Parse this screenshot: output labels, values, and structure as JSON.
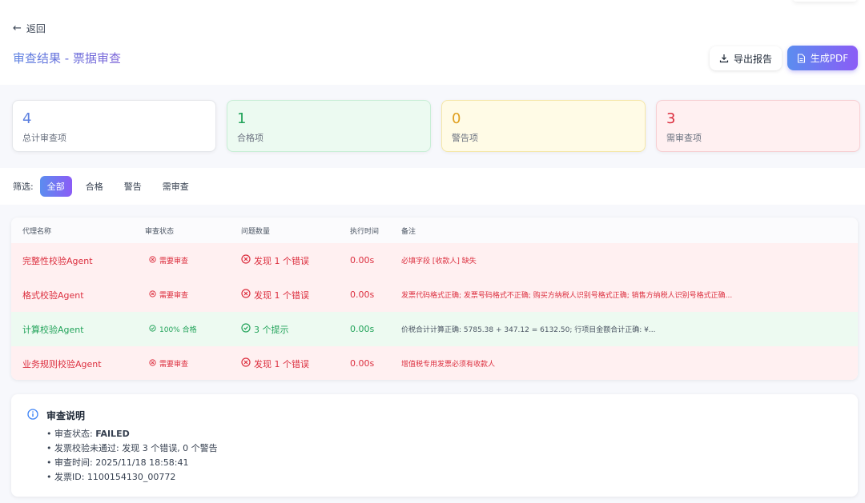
{
  "header": {
    "back_label": "返回",
    "title": "审查结果 - 票据审查",
    "export_label": "导出报告",
    "pdf_label": "生成PDF"
  },
  "stats": [
    {
      "value": "4",
      "label": "总计审查项"
    },
    {
      "value": "1",
      "label": "合格项"
    },
    {
      "value": "0",
      "label": "警告项"
    },
    {
      "value": "3",
      "label": "需审查项"
    }
  ],
  "filter": {
    "label": "筛选:",
    "options": [
      "全部",
      "合格",
      "警告",
      "需审查"
    ],
    "active": "全部"
  },
  "table": {
    "headers": [
      "代理名称",
      "审查状态",
      "问题数量",
      "执行时间",
      "备注"
    ],
    "rows": [
      {
        "name": "完整性校验Agent",
        "status": "需要审查",
        "issues": "发现 1 个错误",
        "time": "0.00s",
        "note": "必填字段 [收款人] 缺失",
        "state": "fail"
      },
      {
        "name": "格式校验Agent",
        "status": "需要审查",
        "issues": "发现 1 个错误",
        "time": "0.00s",
        "note": "发票代码格式正确; 发票号码格式不正确; 购买方纳税人识别号格式正确; 销售方纳税人识别号格式正确...",
        "state": "fail"
      },
      {
        "name": "计算校验Agent",
        "status": "100% 合格",
        "issues": "3 个提示",
        "time": "0.00s",
        "note": "价税合计计算正确: 5785.38 + 347.12 = 6132.50; 行项目金额合计正确: ¥...",
        "state": "pass"
      },
      {
        "name": "业务规则校验Agent",
        "status": "需要审查",
        "issues": "发现 1 个错误",
        "time": "0.00s",
        "note": "增值税专用发票必须有收款人",
        "state": "fail"
      }
    ]
  },
  "notes": {
    "title": "审查说明",
    "items": [
      {
        "label": "审查状态: ",
        "value": "FAILED"
      },
      {
        "label": "发票校验未通过: 发现 3 个错误, 0 个警告",
        "value": ""
      },
      {
        "label": "审查时间: 2025/11/18 18:58:41",
        "value": ""
      },
      {
        "label": "发票ID: 1100154130_00772",
        "value": ""
      }
    ]
  },
  "colors": {
    "accent_start": "#5b8def",
    "accent_end": "#8b5cf6",
    "fail": "#dc2f3f",
    "pass": "#22a35a",
    "warn": "#e0a020"
  }
}
